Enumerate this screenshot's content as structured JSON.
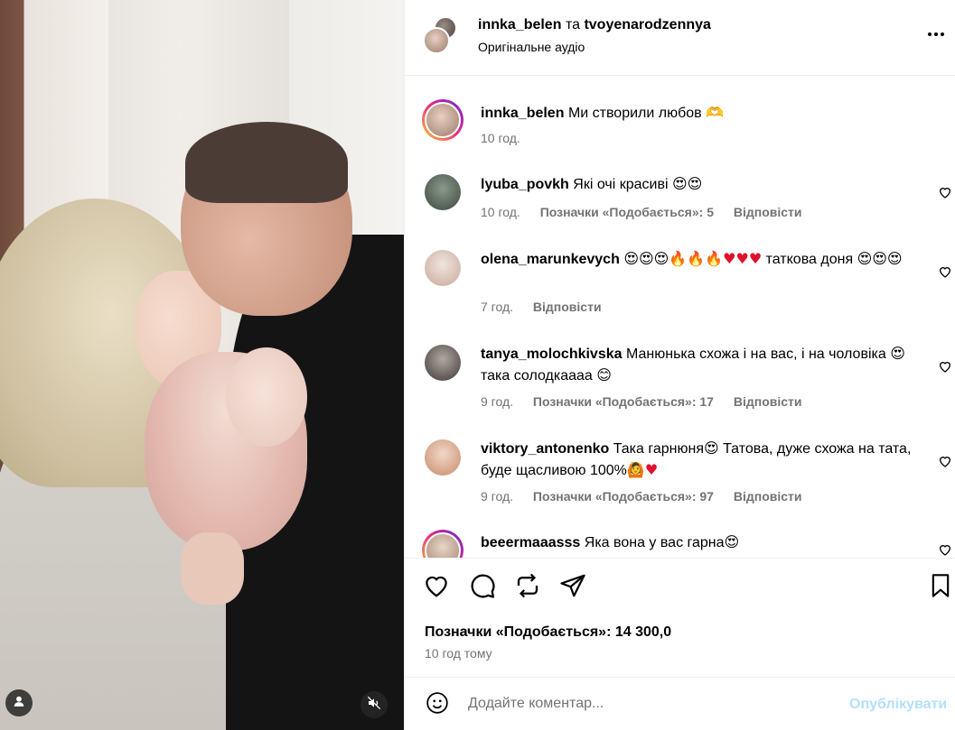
{
  "post": {
    "author": "innka_belen",
    "conjunction": "та",
    "collaborator": "tvoyenarodzennya",
    "audio_label": "Оригінальне аудіо"
  },
  "caption": {
    "user": "innka_belen",
    "text": "Ми створили любов 🫶",
    "time": "10 год."
  },
  "comments": [
    {
      "user": "lyuba_povkh",
      "text": "Які очі красиві 😍😍",
      "time": "10 год.",
      "likes": "Позначки «Подобається»: 5",
      "reply": "Відповісти"
    },
    {
      "user": "olena_marunkevych",
      "text_emoji_a": "😍😍😍🔥🔥🔥",
      "text_hearts": "♥♥♥",
      "text_mid": " таткова доня",
      "text_emoji_b": "😍😍😍",
      "time": "7 год.",
      "reply": "Відповісти"
    },
    {
      "user": "tanya_molochkivska",
      "text": "Манюнька схожа і на вас, і на чоловіка",
      "text_emoji_a": "😍",
      "text_mid": " така солодкаааа ",
      "text_emoji_b": "😊",
      "time": "9 год.",
      "likes": "Позначки «Подобається»: 17",
      "reply": "Відповісти"
    },
    {
      "user": "viktory_antonenko",
      "text": "Така гарнюня",
      "text_emoji_a": "😍",
      "text_mid": " Татова, дуже схожа на тата, буде щасливою 100%",
      "text_emoji_b": "🙆",
      "text_hearts": "♥",
      "time": "9 год.",
      "likes": "Позначки «Подобається»: 97",
      "reply": "Відповісти"
    },
    {
      "user": "beeermaaasss",
      "text": "Яка вона у вас гарна",
      "text_emoji_a": "😍"
    }
  ],
  "actions": {
    "likes": "Позначки «Подобається»: 14 300,0",
    "time_ago": "10 год тому"
  },
  "composer": {
    "placeholder": "Додайте коментар...",
    "post_label": "Опублікувати"
  },
  "colors": {
    "link_disabled": "#b2dffc",
    "muted_text": "#737373",
    "story_ring": [
      "#f9ce34",
      "#ee2a7b",
      "#6228d7"
    ]
  },
  "icons": [
    "user-tag-icon",
    "mute-icon",
    "more-icon",
    "like-icon",
    "comment-icon",
    "repost-icon",
    "share-icon",
    "bookmark-icon",
    "emoji-icon"
  ]
}
